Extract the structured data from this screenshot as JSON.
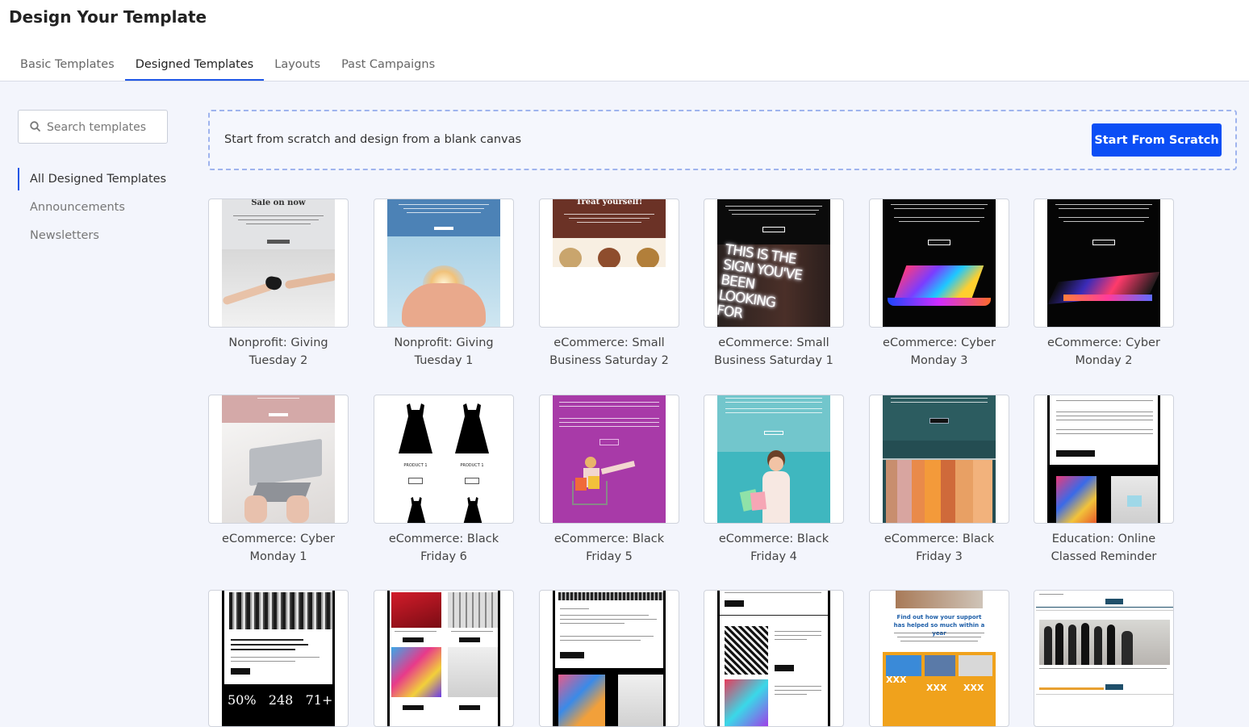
{
  "header": {
    "title": "Design Your Template"
  },
  "tabs": [
    {
      "label": "Basic Templates",
      "active": false
    },
    {
      "label": "Designed Templates",
      "active": true
    },
    {
      "label": "Layouts",
      "active": false
    },
    {
      "label": "Past Campaigns",
      "active": false
    }
  ],
  "search": {
    "placeholder": "Search templates",
    "value": ""
  },
  "sidebar": {
    "items": [
      {
        "label": "All Designed Templates",
        "active": true
      },
      {
        "label": "Announcements",
        "active": false
      },
      {
        "label": "Newsletters",
        "active": false
      }
    ]
  },
  "scratch": {
    "text": "Start from scratch and design from a blank canvas",
    "button_label": "Start From Scratch"
  },
  "accent_color": "#0b4ef5",
  "templates": [
    {
      "label": "Nonprofit: Giving Tuesday 2",
      "thumb_text": "Sale on now"
    },
    {
      "label": "Nonprofit: Giving Tuesday 1"
    },
    {
      "label": "eCommerce: Small Business Saturday 2",
      "thumb_text": "Treat yourself!"
    },
    {
      "label": "eCommerce: Small Business Saturday 1",
      "thumb_text": "THIS IS THE SIGN YOU'VE BEEN LOOKING FOR"
    },
    {
      "label": "eCommerce: Cyber Monday 3"
    },
    {
      "label": "eCommerce: Cyber Monday 2"
    },
    {
      "label": "eCommerce: Cyber Monday 1"
    },
    {
      "label": "eCommerce: Black Friday 6",
      "thumb_text": "PRODUCT 1"
    },
    {
      "label": "eCommerce: Black Friday 5"
    },
    {
      "label": "eCommerce: Black Friday 4"
    },
    {
      "label": "eCommerce: Black Friday 3"
    },
    {
      "label": "Education: Online Classed Reminder"
    },
    {
      "label": "",
      "thumb_text": "50%   248   71+"
    },
    {
      "label": ""
    },
    {
      "label": ""
    },
    {
      "label": ""
    },
    {
      "label": "",
      "thumb_text": "Find out how your support has helped so much within a year",
      "thumb_text_2": "XXX"
    },
    {
      "label": ""
    }
  ]
}
